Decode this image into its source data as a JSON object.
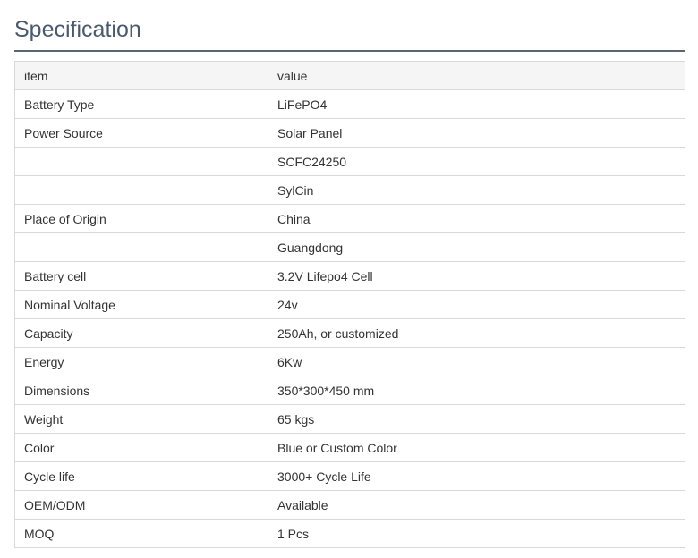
{
  "section": {
    "title": "Specification"
  },
  "table": {
    "header": {
      "item": "item",
      "value": "value"
    },
    "rows": [
      {
        "item": "Battery Type",
        "value": "LiFePO4"
      },
      {
        "item": "Power Source",
        "value": "Solar Panel"
      },
      {
        "item": "",
        "value": "SCFC24250"
      },
      {
        "item": "",
        "value": "SylCin"
      },
      {
        "item": "Place of Origin",
        "value": "China"
      },
      {
        "item": "",
        "value": "Guangdong"
      },
      {
        "item": "Battery cell",
        "value": "3.2V Lifepo4 Cell"
      },
      {
        "item": "Nominal Voltage",
        "value": "24v"
      },
      {
        "item": "Capacity",
        "value": "250Ah, or customized"
      },
      {
        "item": "Energy",
        "value": "6Kw"
      },
      {
        "item": "Dimensions",
        "value": "350*300*450 mm"
      },
      {
        "item": "Weight",
        "value": "65 kgs"
      },
      {
        "item": "Color",
        "value": "Blue or Custom Color"
      },
      {
        "item": "Cycle life",
        "value": "3000+ Cycle Life"
      },
      {
        "item": "OEM/ODM",
        "value": "Available"
      },
      {
        "item": "MOQ",
        "value": "1 Pcs"
      }
    ]
  },
  "colors": {
    "title": "#4a5a6e",
    "rule": "#5a6674",
    "border": "#d9d9d9",
    "header_bg": "#f5f5f5",
    "text": "#333333"
  }
}
